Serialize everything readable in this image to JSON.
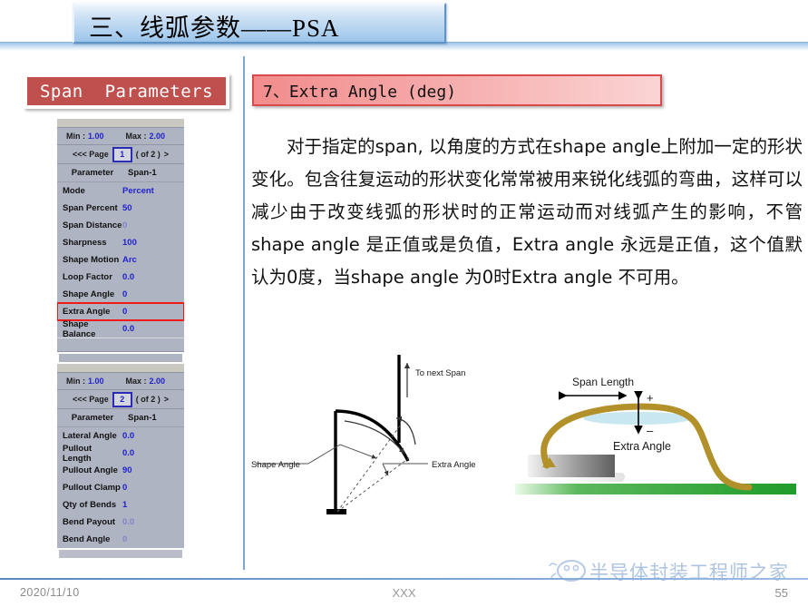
{
  "slide": {
    "title": "三、线弧参数——PSA",
    "left_badge": "Span  Parameters",
    "right_header": "7、Extra Angle (deg)",
    "body": "对于指定的span, 以角度的方式在shape angle上附加一定的形状变化。包含往复运动的形状变化常常被用来锐化线弧的弯曲，这样可以减少由于改变线弧的形状时的正常运动而对线弧产生的影响，不管shape angle 是正值或是负值，Extra angle 永远是正值，这个值默认为0度，当shape angle 为0时Extra angle 不可用。"
  },
  "screenshot": {
    "page1": {
      "min_label": "Min :",
      "min_value": "1.00",
      "max_label": "Max :",
      "max_value": "2.00",
      "prev_label": "<<< Page",
      "page_value": "1",
      "of_label": "( of 2 )",
      "next_label": ">",
      "col_parameter": "Parameter",
      "col_span": "Span-1",
      "rows": [
        {
          "name": "Mode",
          "value": "Percent",
          "dim": false,
          "highlight": false
        },
        {
          "name": "Span Percent",
          "value": "50",
          "dim": false,
          "highlight": false
        },
        {
          "name": "Span Distance",
          "value": "0",
          "dim": true,
          "highlight": false
        },
        {
          "name": "Sharpness",
          "value": "100",
          "dim": false,
          "highlight": false
        },
        {
          "name": "Shape Motion",
          "value": "Arc",
          "dim": false,
          "highlight": false
        },
        {
          "name": "Loop Factor",
          "value": "0.0",
          "dim": false,
          "highlight": false
        },
        {
          "name": "Shape Angle",
          "value": "0",
          "dim": false,
          "highlight": false
        },
        {
          "name": "Extra Angle",
          "value": "0",
          "dim": false,
          "highlight": true
        },
        {
          "name": "Shape Balance",
          "value": "0.0",
          "dim": false,
          "highlight": false
        }
      ]
    },
    "page2": {
      "min_label": "Min :",
      "min_value": "1.00",
      "max_label": "Max :",
      "max_value": "2.00",
      "prev_label": "<<< Page",
      "page_value": "2",
      "of_label": "( of 2 )",
      "next_label": ">",
      "col_parameter": "Parameter",
      "col_span": "Span-1",
      "rows": [
        {
          "name": "Lateral Angle",
          "value": "0.0",
          "dim": false,
          "highlight": false
        },
        {
          "name": "Pullout Length",
          "value": "0.0",
          "dim": false,
          "highlight": false
        },
        {
          "name": "Pullout Angle",
          "value": "90",
          "dim": false,
          "highlight": false
        },
        {
          "name": "Pullout Clamp",
          "value": "0",
          "dim": false,
          "highlight": false
        },
        {
          "name": "Qty of Bends",
          "value": "1",
          "dim": false,
          "highlight": false
        },
        {
          "name": "Bend Payout",
          "value": "0.0",
          "dim": true,
          "highlight": false
        },
        {
          "name": "Bend Angle",
          "value": "0",
          "dim": true,
          "highlight": false
        }
      ]
    }
  },
  "diagram_left": {
    "to_next_span": "To next Span",
    "shape_angle": "Shape Angle",
    "extra_angle": "Extra Angle"
  },
  "diagram_right": {
    "span_length": "Span Length",
    "extra_angle": "Extra Angle",
    "plus": "+",
    "minus": "–"
  },
  "footer": {
    "date": "2020/11/10",
    "center": "XXX",
    "page": "55",
    "watermark": "半导体封装工程师之家"
  },
  "colors": {
    "badge_red": "#c0504d",
    "header_red": "#d94a4a",
    "highlight_red": "#f21b1b",
    "value_blue": "#2222cc",
    "divider_blue": "#7ba7d7"
  }
}
